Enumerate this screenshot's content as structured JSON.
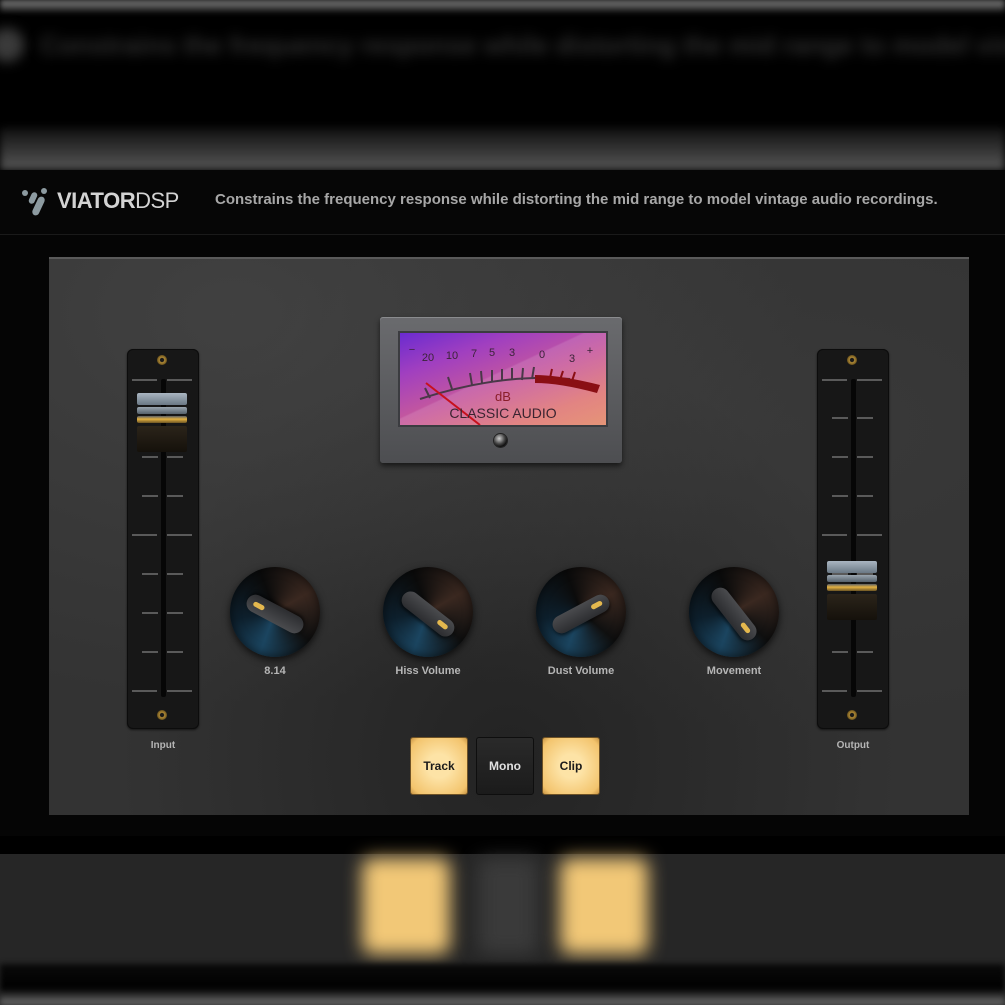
{
  "header": {
    "logo_bold": "VIATOR",
    "logo_light": "DSP",
    "tagline": "Constrains the frequency response while distorting the mid range to model vintage audio recordings."
  },
  "vu_meter": {
    "scale_labels": [
      "−",
      "20",
      "10",
      "7",
      "5",
      "3",
      "0",
      "3",
      "+"
    ],
    "unit": "dB",
    "brand": "CLASSIC AUDIO",
    "needle_level": "-20 dB (resting)",
    "colors": {
      "face_top": "#6a2bd0",
      "face_bottom": "#e48f70",
      "red_zone": "#8a0f14"
    }
  },
  "faders": [
    {
      "id": "input",
      "label": "Input",
      "value_fraction": 0.9
    },
    {
      "id": "output",
      "label": "Output",
      "value_fraction": 0.35
    }
  ],
  "knobs": [
    {
      "id": "knob-1",
      "label": "8.14",
      "value_fraction": 0.2
    },
    {
      "id": "hiss-volume",
      "label": "Hiss Volume",
      "value_fraction": 0.65
    },
    {
      "id": "dust-volume",
      "label": "Dust Volume",
      "value_fraction": 0.4
    },
    {
      "id": "movement",
      "label": "Movement",
      "value_fraction": 0.7
    }
  ],
  "buttons": [
    {
      "id": "track",
      "label": "Track",
      "active": true
    },
    {
      "id": "mono",
      "label": "Mono",
      "active": false
    },
    {
      "id": "clip",
      "label": "Clip",
      "active": true
    }
  ],
  "colors": {
    "accent": "#f3c46d",
    "panel": "#333333",
    "led": "#e4b84e"
  }
}
